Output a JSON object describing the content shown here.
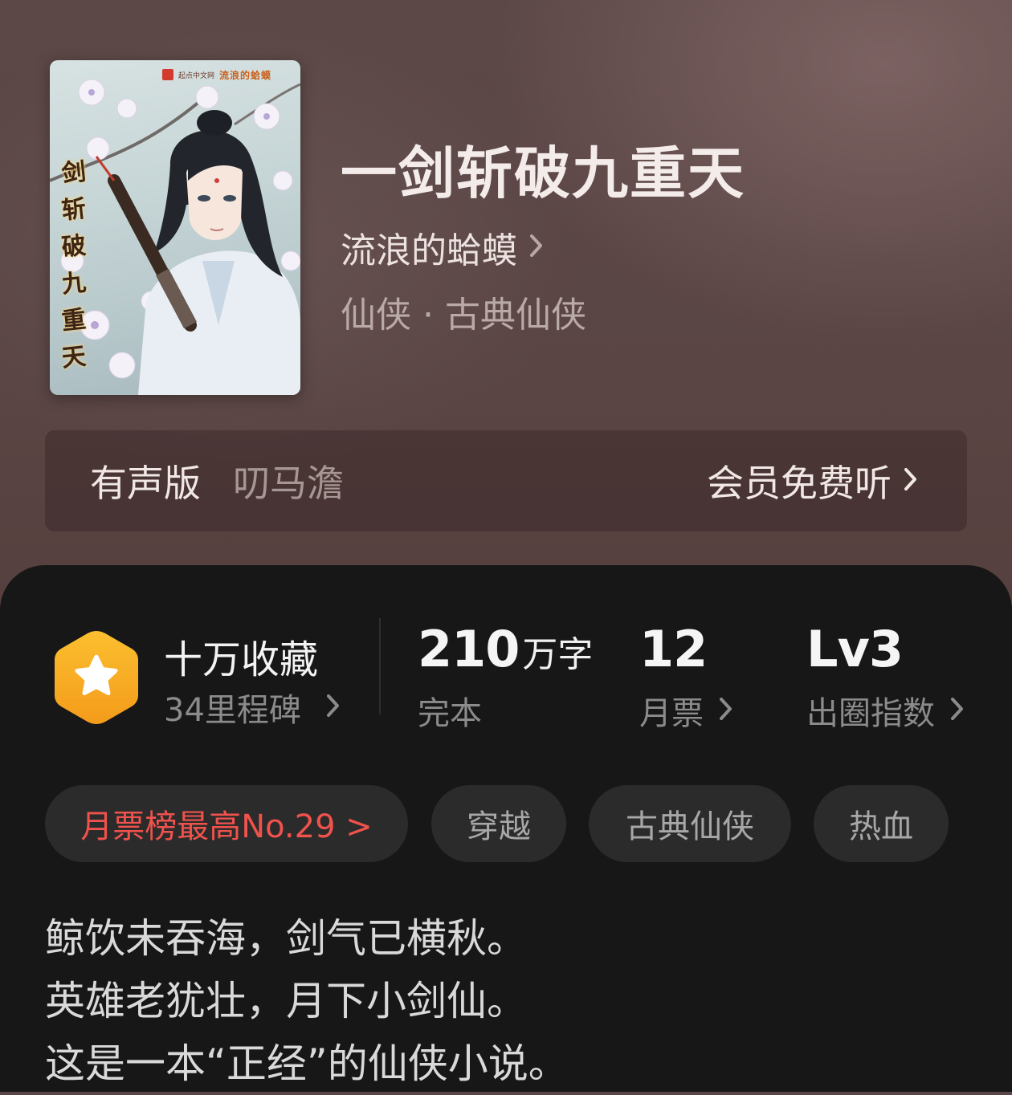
{
  "book": {
    "title": "一剑斩破九重天",
    "author": "流浪的蛤蟆",
    "genre": "仙侠 · 古典仙侠",
    "cover": {
      "title_chars": [
        "剑",
        "斩",
        "破",
        "九",
        "重",
        "天"
      ],
      "brand_text": "起点中文网",
      "brand_title": "流浪的蛤蟆"
    }
  },
  "audio": {
    "label": "有声版",
    "narrator": "叨马澹",
    "action": "会员免费听"
  },
  "stats": {
    "favorites": {
      "main": "十万收藏",
      "milestones": "34里程碑"
    },
    "words": {
      "value": "210",
      "unit": "万字",
      "status": "完本"
    },
    "monthly_tickets": {
      "value": "12",
      "label": "月票"
    },
    "influence": {
      "value": "Lv3",
      "label": "出圈指数"
    }
  },
  "tags": {
    "rank": "月票榜最高No.29 >",
    "items": [
      "穿越",
      "古典仙侠",
      "热血"
    ]
  },
  "description": [
    "鲸饮未吞海，剑气已横秋。",
    "英雄老犹壮，月下小剑仙。",
    "这是一本“正经”的仙侠小说。"
  ],
  "colors": {
    "panel_bg": "#171717",
    "tag_bg": "#2b2b2b",
    "rank_red": "#f0524c",
    "badge_orange": "#f5a623"
  },
  "icons": {
    "badge": "star-hexagon-icon",
    "chevron": "chevron-right-icon"
  }
}
